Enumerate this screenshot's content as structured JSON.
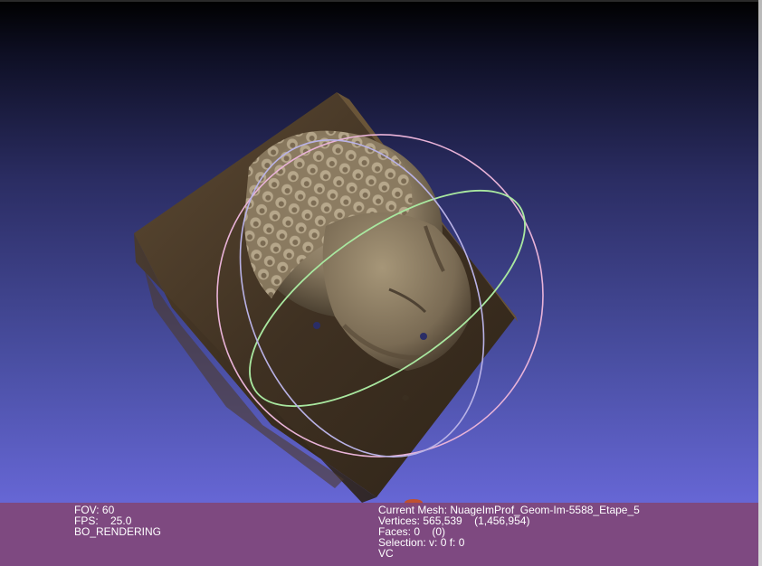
{
  "viewer": {
    "background_top": "#000000",
    "background_bottom": "#6d6de0",
    "info_panel_color": "#804678"
  },
  "info": {
    "left": {
      "fov": "FOV: 60",
      "fps": "FPS:    25.0",
      "render_mode": "BO_RENDERING"
    },
    "right": {
      "current_mesh": "Current Mesh: NuageImProf_Geom-Im-5588_Etape_5",
      "vertices": "Vertices: 565,539    (1,456,954)",
      "faces": "Faces: 0    (0)",
      "selection": "Selection: v: 0 f: 0",
      "vc": "VC"
    }
  },
  "scene": {
    "object": "buddha-head-relief-point-cloud",
    "trackball": {
      "ring_colors": [
        "#e9b3d8",
        "#a9e8a0",
        "#b9b2e6"
      ]
    }
  }
}
